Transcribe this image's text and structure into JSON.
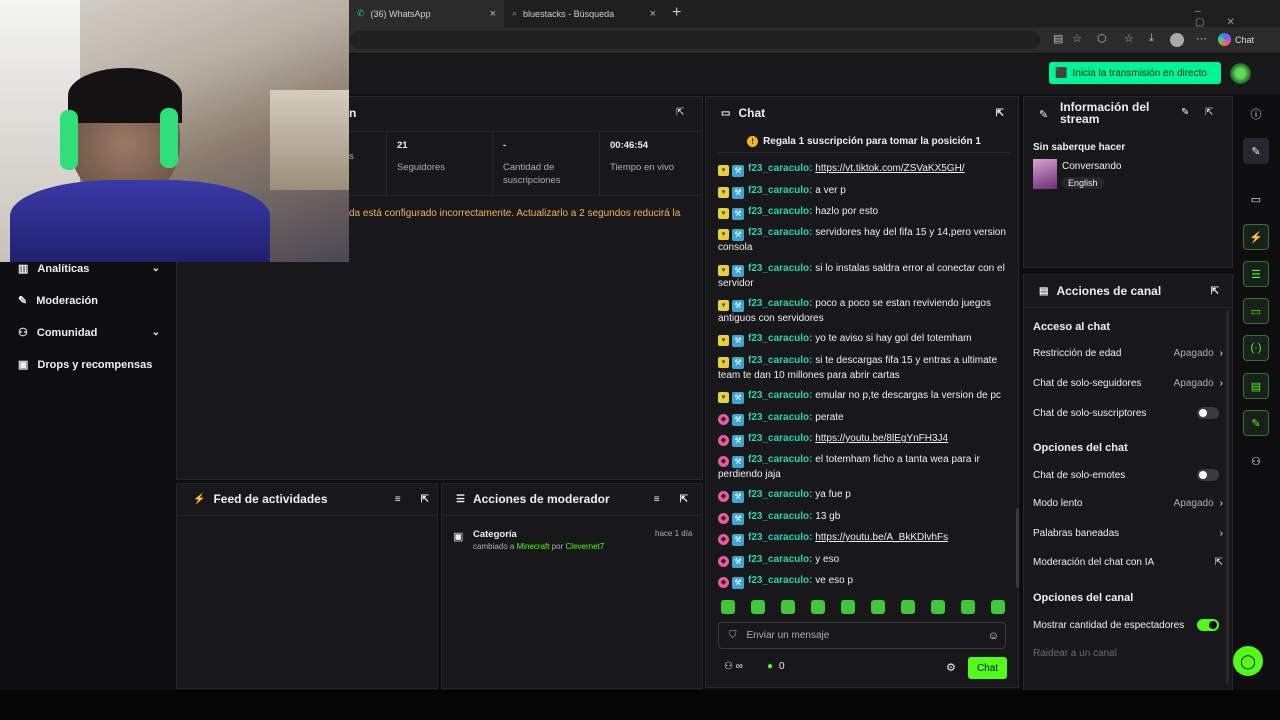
{
  "browser": {
    "tabs": [
      {
        "title": "(36) WhatsApp",
        "icon": "whatsapp-icon"
      },
      {
        "title": "bluestacks - Búsqueda",
        "icon": "search-icon"
      }
    ],
    "copilot_label": "Chat"
  },
  "topbar": {
    "go_live": "Inicia la transmisión en directo"
  },
  "nav": {
    "items": [
      {
        "label": "Analíticas",
        "icon": "chart-icon"
      },
      {
        "label": "Moderación",
        "icon": "wrench-icon"
      },
      {
        "label": "Comunidad",
        "icon": "community-icon"
      },
      {
        "label": "Drops y recompensas",
        "icon": "gift-icon"
      }
    ]
  },
  "session": {
    "title_fragment": "n",
    "stats": [
      {
        "value": "",
        "label": "s"
      },
      {
        "value": "21",
        "label": "Seguidores"
      },
      {
        "value": "-",
        "label": "Cantidad de suscripciones"
      },
      {
        "value": "00:46:54",
        "label": "Tiempo en vivo"
      }
    ],
    "warning": "da está configurado incorrectamente. Actualizarlo a 2 segundos reducirá la"
  },
  "activity_feed": {
    "title": "Feed de actividades"
  },
  "mod_actions": {
    "title": "Acciones de moderador",
    "entries": [
      {
        "type": "Categoría",
        "time": "hace 1 día",
        "pre": "cambiado a",
        "target": "Minecraft",
        "by": "por",
        "user": "Clevernet7"
      }
    ]
  },
  "chat": {
    "title": "Chat",
    "pinned": "Regala 1 suscripción para tomar la posición 1",
    "messages": [
      {
        "badge": "y",
        "user": "f23_caraculo:",
        "text": "https://vt.tiktok.com/ZSVaKX5GH/",
        "link": true
      },
      {
        "badge": "y",
        "user": "f23_caraculo:",
        "text": "a ver p"
      },
      {
        "badge": "y",
        "user": "f23_caraculo:",
        "text": "hazlo por esto"
      },
      {
        "badge": "y",
        "user": "f23_caraculo:",
        "text": "servidores hay del fifa 15 y 14,pero version consola"
      },
      {
        "badge": "y",
        "user": "f23_caraculo:",
        "text": "si lo instalas saldra error al conectar con el servidor"
      },
      {
        "badge": "y",
        "user": "f23_caraculo:",
        "text": "poco a poco se estan reviviendo juegos antiguos con servidores"
      },
      {
        "badge": "y",
        "user": "f23_caraculo:",
        "text": "yo te aviso si hay gol del totemham"
      },
      {
        "badge": "y",
        "user": "f23_caraculo:",
        "text": "si te descargas fifa 15 y entras a ultimate team te dan 10 millones para abrir cartas"
      },
      {
        "badge": "y",
        "user": "f23_caraculo:",
        "text": "emular no p,te descargas la version de pc"
      },
      {
        "badge": "p",
        "user": "f23_caraculo:",
        "text": "perate"
      },
      {
        "badge": "p",
        "user": "f23_caraculo:",
        "text": "https://youtu.be/8lEgYnFH3J4",
        "link": true
      },
      {
        "badge": "p",
        "user": "f23_caraculo:",
        "text": "el totemham ficho a tanta wea para ir perdiendo jaja"
      },
      {
        "badge": "p",
        "user": "f23_caraculo:",
        "text": "ya fue p"
      },
      {
        "badge": "p",
        "user": "f23_caraculo:",
        "text": "13 gb"
      },
      {
        "badge": "p",
        "user": "f23_caraculo:",
        "text": "https://youtu.be/A_BkKDlvhFs",
        "link": true
      },
      {
        "badge": "p",
        "user": "f23_caraculo:",
        "text": "y eso"
      },
      {
        "badge": "p",
        "user": "f23_caraculo:",
        "text": "ve eso p"
      }
    ],
    "input_placeholder": "Enviar un mensaje",
    "points": "0",
    "send_label": "Chat"
  },
  "stream_info": {
    "title": "Información del stream",
    "stream_title": "Sin saberque hacer",
    "category": "Conversando",
    "language": "English"
  },
  "channel_actions": {
    "title": "Acciones de canal",
    "sections": [
      {
        "heading": "Acceso al chat",
        "rows": [
          {
            "label": "Restricción de edad",
            "value": "Apagado",
            "kind": "arrow"
          },
          {
            "label": "Chat de solo-seguidores",
            "value": "Apagado",
            "kind": "arrow"
          },
          {
            "label": "Chat de solo-suscriptores",
            "kind": "toggle",
            "on": false
          }
        ]
      },
      {
        "heading": "Opciones del chat",
        "rows": [
          {
            "label": "Chat de solo-emotes",
            "kind": "toggle",
            "on": false
          },
          {
            "label": "Modo lento",
            "value": "Apagado",
            "kind": "arrow"
          },
          {
            "label": "Palabras baneadas",
            "kind": "arrow"
          },
          {
            "label": "Moderación del chat con IA",
            "kind": "external"
          }
        ]
      },
      {
        "heading": "Opciones del canal",
        "rows": [
          {
            "label": "Mostrar cantidad de espectadores",
            "kind": "toggle",
            "on": true
          },
          {
            "label": "Raidear a un canal",
            "kind": "muted"
          }
        ]
      }
    ]
  },
  "colors": {
    "accent": "#53fc18",
    "go_live": "#00f593"
  }
}
